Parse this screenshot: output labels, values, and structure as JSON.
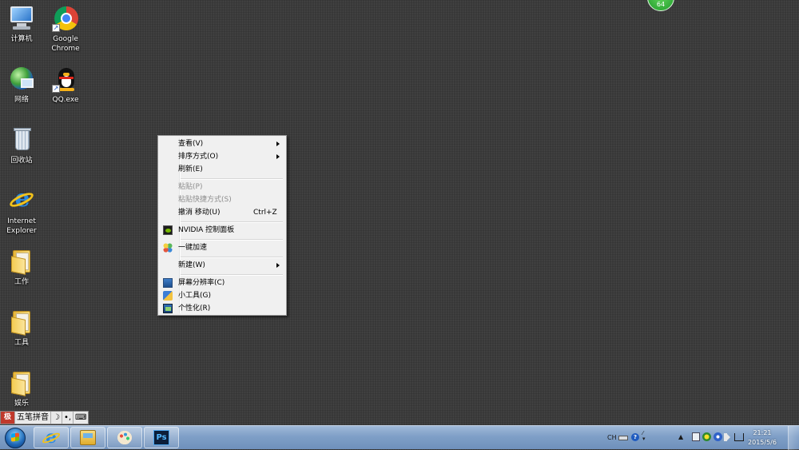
{
  "desktop": {
    "icons": [
      {
        "label": "计算机",
        "icon": "computer-icon"
      },
      {
        "label": "Google Chrome",
        "icon": "chrome-icon"
      },
      {
        "label": "网络",
        "icon": "network-icon"
      },
      {
        "label": "QQ.exe",
        "icon": "qq-icon"
      },
      {
        "label": "回收站",
        "icon": "recycle-bin-icon"
      },
      {
        "label": "Internet Explorer",
        "icon": "ie-icon"
      },
      {
        "label": "工作",
        "icon": "folder-icon"
      },
      {
        "label": "工具",
        "icon": "folder-icon"
      },
      {
        "label": "娱乐",
        "icon": "folder-icon"
      }
    ],
    "badge_text": "64"
  },
  "context_menu": {
    "items": [
      {
        "label": "查看(V)",
        "submenu": true
      },
      {
        "label": "排序方式(O)",
        "submenu": true
      },
      {
        "label": "刷新(E)"
      },
      {
        "label": "粘贴(P)",
        "disabled": true
      },
      {
        "label": "粘贴快捷方式(S)",
        "disabled": true
      },
      {
        "label": "撤消 移动(U)",
        "shortcut": "Ctrl+Z"
      },
      {
        "label": "NVIDIA 控制面板",
        "icon": "nvidia-icon"
      },
      {
        "label": "一键加速",
        "icon": "speedup-icon"
      },
      {
        "label": "新建(W)",
        "submenu": true
      },
      {
        "label": "屏幕分辨率(C)",
        "icon": "display-icon"
      },
      {
        "label": "小工具(G)",
        "icon": "gadgets-icon"
      },
      {
        "label": "个性化(R)",
        "icon": "personalize-icon"
      }
    ]
  },
  "ime_bar": {
    "logo": "极",
    "mode": "五笔拼音",
    "moon": "☽",
    "punct": "•,",
    "keyboard": "⌨"
  },
  "taskbar": {
    "pinned": [
      "ie-icon",
      "explorer-icon",
      "paint-icon",
      "photoshop-icon"
    ],
    "ps_label": "Ps",
    "tray": {
      "lang": "CH",
      "help": "?",
      "up_arrow": "▲"
    },
    "clock": {
      "time": "21:21",
      "date": "2015/5/6"
    }
  },
  "colors": {
    "desktop_bg": "#3b3b3b",
    "menu_bg": "#f0f0f0",
    "taskbar": "#7f9fc7",
    "badge": "#1f9a2a"
  }
}
